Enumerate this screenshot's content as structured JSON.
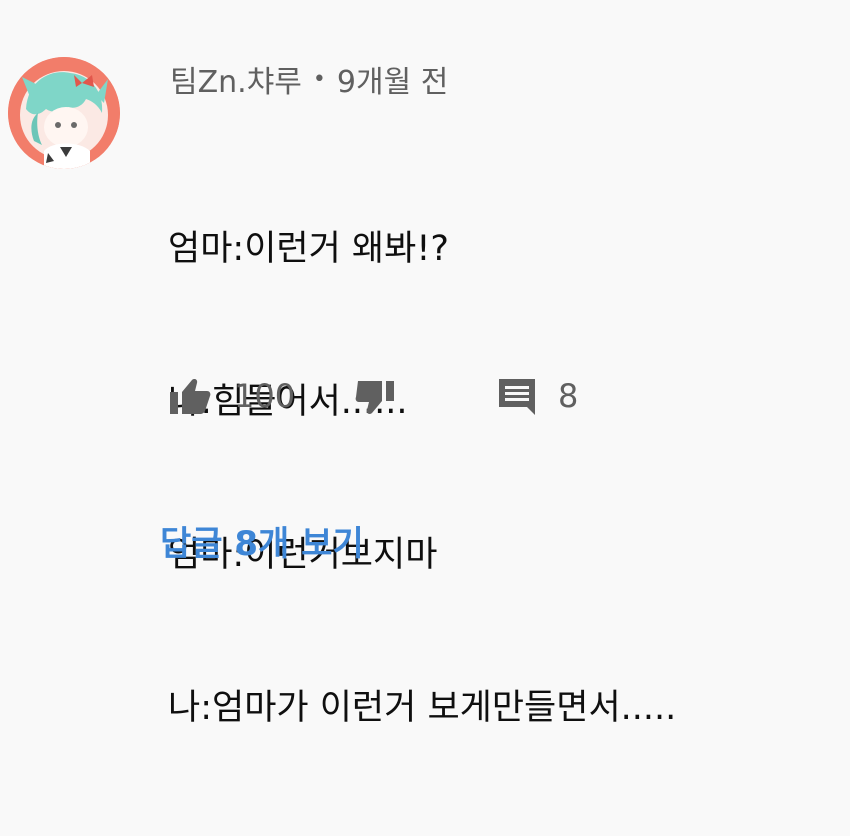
{
  "comment": {
    "author": "팀Zn.챠루",
    "separator": "•",
    "time": "9개월 전",
    "lines": [
      "엄마:이런거 왜봐!?",
      "나:힘들어서......",
      "엄마:이런거보지마",
      "나:엄마가 이런거 보게만들면서....."
    ],
    "like_count": "100",
    "reply_count": "8",
    "view_replies_label": "답글 8개 보기"
  },
  "icons": {
    "like": "thumbs-up-icon",
    "dislike": "thumbs-down-icon",
    "reply": "comment-icon"
  },
  "colors": {
    "link": "#3e86d6",
    "meta": "#606060",
    "text": "#0f0f0f",
    "avatar_bg": "#f27d6a",
    "background": "#f9f9f9"
  }
}
